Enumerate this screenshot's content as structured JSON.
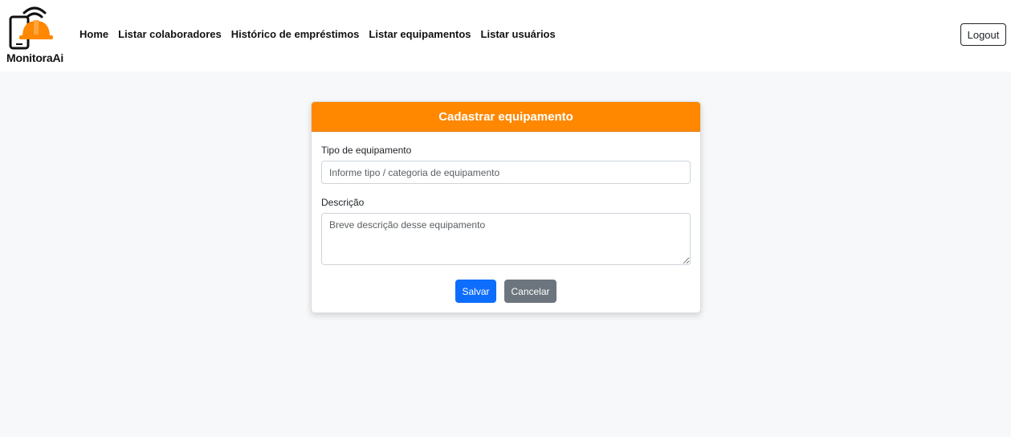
{
  "brand": {
    "name": "MonitoraAi",
    "logo_icon": "phone-hardhat-wifi-icon",
    "accent_color": "#ff8800"
  },
  "nav": {
    "items": [
      {
        "label": "Home"
      },
      {
        "label": "Listar colaboradores"
      },
      {
        "label": "Histórico de empréstimos"
      },
      {
        "label": "Listar equipamentos"
      },
      {
        "label": "Listar usuários"
      }
    ],
    "logout_label": "Logout"
  },
  "form": {
    "title": "Cadastrar equipamento",
    "type_label": "Tipo de equipamento",
    "type_placeholder": "Informe tipo / categoria de equipamento",
    "type_value": "",
    "description_label": "Descrição",
    "description_placeholder": "Breve descrição desse equipamento",
    "description_value": "",
    "save_label": "Salvar",
    "cancel_label": "Cancelar"
  },
  "colors": {
    "header": "#ff8800",
    "save_button": "#0d6efd",
    "cancel_button": "#6c757d",
    "page_background": "#f7f8fa"
  }
}
